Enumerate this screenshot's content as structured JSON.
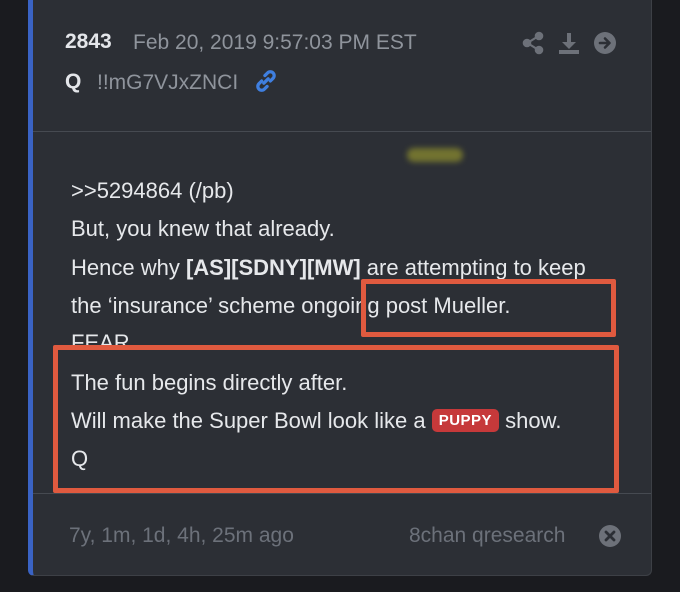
{
  "post": {
    "number": "2843",
    "timestamp": "Feb 20, 2019 9:57:03 PM EST",
    "author": "Q",
    "tripcode": "!!mG7VJxZNCI"
  },
  "message": {
    "line1": ">>5294864 (/pb)",
    "line2": "But, you knew that already.",
    "line3_prefix": "Hence why ",
    "line3_bold": "[AS][SDNY][MW]",
    "line3_suffix": " are attempting to keep",
    "line4": "the ‘insurance’ scheme ongoing post Mueller.",
    "line5": "FEAR",
    "line6": "The fun begins directly after.",
    "line7_prefix": "Will make the Super Bowl look like a ",
    "line7_badge": "PUPPY",
    "line7_suffix": " show.",
    "line8": "Q"
  },
  "footer": {
    "ago": "7y, 1m, 1d, 4h, 25m ago",
    "board": "8chan qresearch"
  },
  "icons": {
    "header_actions": [
      "share-icon",
      "download-icon",
      "arrow-right-circle-icon"
    ],
    "author_link": "link-icon",
    "footer_close": "close-circle-icon"
  },
  "colors": {
    "card_background": "#2c2f35",
    "accent_border": "#3a63c4",
    "highlight_box": "#e05a3f",
    "badge": "#c6393a",
    "link": "#3f7fe0"
  }
}
